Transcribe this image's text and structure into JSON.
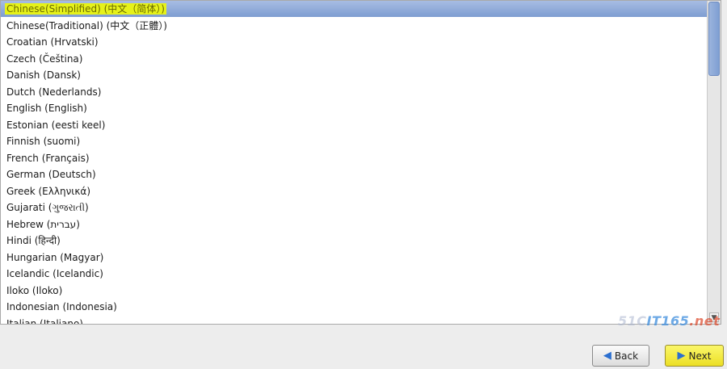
{
  "language_list": {
    "items": [
      {
        "label": "Chinese(Simplified) (中文（简体）)",
        "selected": true
      },
      {
        "label": "Chinese(Traditional) (中文（正體）)"
      },
      {
        "label": "Croatian (Hrvatski)"
      },
      {
        "label": "Czech (Čeština)"
      },
      {
        "label": "Danish (Dansk)"
      },
      {
        "label": "Dutch (Nederlands)"
      },
      {
        "label": "English (English)"
      },
      {
        "label": "Estonian (eesti keel)"
      },
      {
        "label": "Finnish (suomi)"
      },
      {
        "label": "French (Français)"
      },
      {
        "label": "German (Deutsch)"
      },
      {
        "label": "Greek (Ελληνικά)"
      },
      {
        "label": "Gujarati (ગુજરાતી)"
      },
      {
        "label": "Hebrew (עברית)"
      },
      {
        "label": "Hindi (हिन्दी)"
      },
      {
        "label": "Hungarian (Magyar)"
      },
      {
        "label": "Icelandic (Icelandic)"
      },
      {
        "label": "Iloko (Iloko)"
      },
      {
        "label": "Indonesian (Indonesia)"
      },
      {
        "label": "Italian (Italiano)"
      }
    ]
  },
  "buttons": {
    "back_label": "Back",
    "next_label": "Next"
  },
  "icons": {
    "back": "arrow-left-icon",
    "next": "arrow-right-icon",
    "scroll_down": "chevron-down-icon"
  },
  "watermark": {
    "text_left": "51C",
    "text_mid": "IT165",
    "text_right": ".net"
  },
  "colors": {
    "selection": "#8aa6d6",
    "highlight": "#e6f21a",
    "next_button": "#ecdf25"
  }
}
